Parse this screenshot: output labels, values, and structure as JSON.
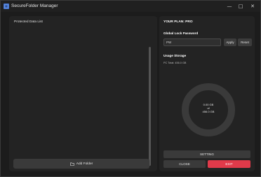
{
  "window": {
    "title": "SecureFolder Manager",
    "controls": {
      "minimize_icon": "minimize-icon",
      "minimize_glyph": "—",
      "maximize_icon": "maximize-icon",
      "maximize_glyph": "□",
      "close_icon": "close-icon",
      "close_glyph": "✕"
    }
  },
  "left_panel": {
    "title": "Protected Data List",
    "items": [],
    "add_folder_label": "Add Folder",
    "add_folder_icon": "folder-icon"
  },
  "right_panel": {
    "plan_label": "YOUR PLAN: PRO",
    "lock_password": {
      "label": "Global Lock Password",
      "value": "PW",
      "placeholder": "",
      "apply_label": "Apply",
      "reset_label": "Reset"
    },
    "storage": {
      "label": "Usage Storage",
      "pc_total": "PC Total: 456.0 GB",
      "used": "0.00 GB",
      "of_label": "of",
      "total": "456.0 GB",
      "used_fraction": 0.0
    },
    "buttons": {
      "setting": "SETTING",
      "close": "CLOSE",
      "exit": "EXIT"
    }
  },
  "colors": {
    "background": "#1c1c1c",
    "panel": "#232323",
    "button": "#3a3a3a",
    "exit_accent": "#e03a4a",
    "donut_track": "#3a3a3a"
  }
}
